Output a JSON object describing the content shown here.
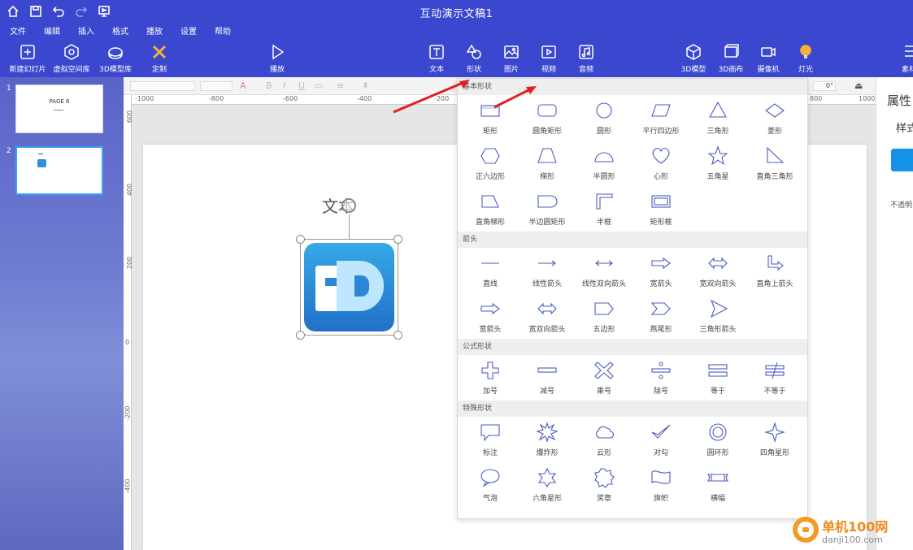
{
  "titlebar": {
    "title": "互动演示文稿1"
  },
  "menu": [
    "文件",
    "编辑",
    "插入",
    "格式",
    "播放",
    "设置",
    "帮助"
  ],
  "toolbar": {
    "new_slide": "新建幻灯片",
    "virtual_space": "虚拟空间库",
    "model_3d_lib": "3D模型库",
    "custom": "定制",
    "play": "播放",
    "text": "文本",
    "shape": "形状",
    "image": "图片",
    "video": "视频",
    "audio": "音频",
    "model_3d": "3D模型",
    "canvas_3d": "3D画布",
    "camera": "摄像机",
    "light": "灯光",
    "assets": "素材"
  },
  "slides": [
    {
      "num": "1",
      "title": "PAGE 6"
    },
    {
      "num": "2"
    }
  ],
  "fmtbar": {
    "rotation": "0°"
  },
  "ruler_h": [
    "-1000",
    "-800",
    "-600",
    "-400",
    "-200",
    "0",
    "800",
    "1000"
  ],
  "ruler_v": [
    "600",
    "400",
    "200",
    "0",
    "-200",
    "-400"
  ],
  "canvas": {
    "text_box": "文本"
  },
  "right_panel": {
    "title": "属性",
    "style": "样式",
    "opacity": "不透明"
  },
  "shape_panel": {
    "sections": [
      {
        "title": "基本形状",
        "items": [
          {
            "label": "矩形",
            "icon": "rect"
          },
          {
            "label": "圆角矩形",
            "icon": "roundrect"
          },
          {
            "label": "圆形",
            "icon": "circle"
          },
          {
            "label": "平行四边形",
            "icon": "parallelogram"
          },
          {
            "label": "三角形",
            "icon": "triangle"
          },
          {
            "label": "菱形",
            "icon": "diamond"
          },
          {
            "label": "正六边形",
            "icon": "hexagon"
          },
          {
            "label": "梯形",
            "icon": "trapezoid"
          },
          {
            "label": "半圆形",
            "icon": "semicircle"
          },
          {
            "label": "心形",
            "icon": "heart"
          },
          {
            "label": "五角星",
            "icon": "star5"
          },
          {
            "label": "直角三角形",
            "icon": "righttri"
          },
          {
            "label": "直角梯形",
            "icon": "righttrap"
          },
          {
            "label": "半边圆矩形",
            "icon": "halfroundrect"
          },
          {
            "label": "半框",
            "icon": "halfframe"
          },
          {
            "label": "矩形框",
            "icon": "frame"
          }
        ]
      },
      {
        "title": "箭头",
        "items": [
          {
            "label": "直线",
            "icon": "line"
          },
          {
            "label": "线性箭头",
            "icon": "arrowline"
          },
          {
            "label": "线性双向箭头",
            "icon": "arrowline2"
          },
          {
            "label": "宽箭头",
            "icon": "widearrow"
          },
          {
            "label": "宽双向箭头",
            "icon": "widearrow2"
          },
          {
            "label": "直角上箭头",
            "icon": "bentarrow"
          },
          {
            "label": "宽箭头",
            "icon": "widearrow"
          },
          {
            "label": "宽双向箭头",
            "icon": "widearrow2"
          },
          {
            "label": "五边形",
            "icon": "pentagon"
          },
          {
            "label": "燕尾形",
            "icon": "chevron"
          },
          {
            "label": "三角形箭头",
            "icon": "triarrow"
          }
        ]
      },
      {
        "title": "公式形状",
        "items": [
          {
            "label": "加号",
            "icon": "plus"
          },
          {
            "label": "减号",
            "icon": "minus"
          },
          {
            "label": "乘号",
            "icon": "multiply"
          },
          {
            "label": "除号",
            "icon": "divide"
          },
          {
            "label": "等于",
            "icon": "equal"
          },
          {
            "label": "不等于",
            "icon": "notequal"
          }
        ]
      },
      {
        "title": "特殊形状",
        "items": [
          {
            "label": "标注",
            "icon": "callout"
          },
          {
            "label": "爆炸形",
            "icon": "explosion"
          },
          {
            "label": "云形",
            "icon": "cloud"
          },
          {
            "label": "对勾",
            "icon": "check"
          },
          {
            "label": "圆环形",
            "icon": "donut"
          },
          {
            "label": "四角星形",
            "icon": "star4"
          },
          {
            "label": "气泡",
            "icon": "bubble"
          },
          {
            "label": "六角星形",
            "icon": "star6"
          },
          {
            "label": "奖章",
            "icon": "badge"
          },
          {
            "label": "旗帜",
            "icon": "flag"
          },
          {
            "label": "横幅",
            "icon": "banner"
          }
        ]
      }
    ]
  },
  "watermark": {
    "name": "单机100网",
    "url": "danji100.com"
  },
  "colors": {
    "accent": "#3b47cf",
    "shape_stroke": "#4a5bc0",
    "arrow": "#e02020"
  }
}
